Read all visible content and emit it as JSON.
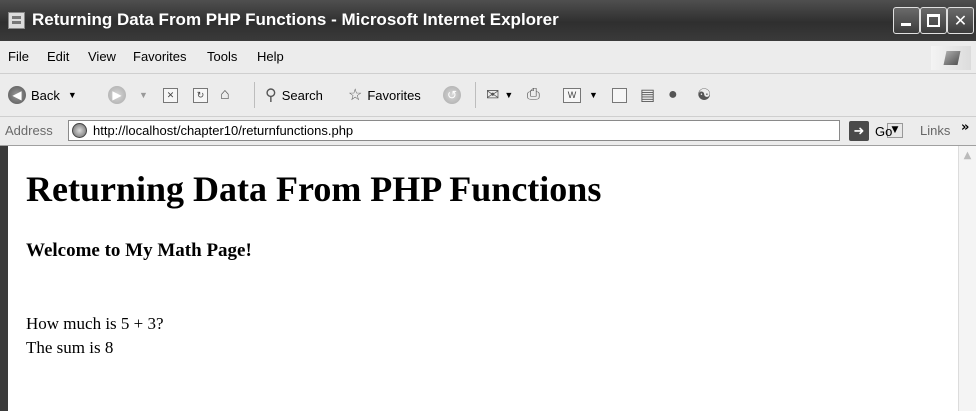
{
  "window": {
    "title": "Returning Data From PHP Functions - Microsoft Internet Explorer",
    "controls": {
      "minimize": "minimize",
      "maximize": "maximize",
      "close": "✕"
    }
  },
  "menu": [
    "File",
    "Edit",
    "View",
    "Favorites",
    "Tools",
    "Help"
  ],
  "toolbar": {
    "back_label": "Back",
    "search_label": "Search",
    "favorites_label": "Favorites"
  },
  "address": {
    "label": "Address",
    "url": "http://localhost/chapter10/returnfunctions.php",
    "go_label": "Go",
    "links_label": "Links",
    "more": "»"
  },
  "page": {
    "heading": "Returning Data From PHP Functions",
    "subheading": "Welcome to My Math Page!",
    "lines": [
      "How much is 5 + 3?",
      "The sum is 8"
    ]
  },
  "icons": {
    "back": "left-arrow-icon",
    "forward": "right-arrow-icon",
    "stop": "stop-icon",
    "refresh": "refresh-icon",
    "home": "home-icon",
    "search": "search-icon",
    "favorites": "star-icon",
    "history": "history-icon",
    "mail": "mail-icon",
    "print": "print-icon",
    "edit": "word-icon",
    "discuss": "discuss-icon",
    "research": "research-icon",
    "messenger": "messenger-icon",
    "page": "ie-page-icon",
    "go": "go-arrow-icon"
  }
}
